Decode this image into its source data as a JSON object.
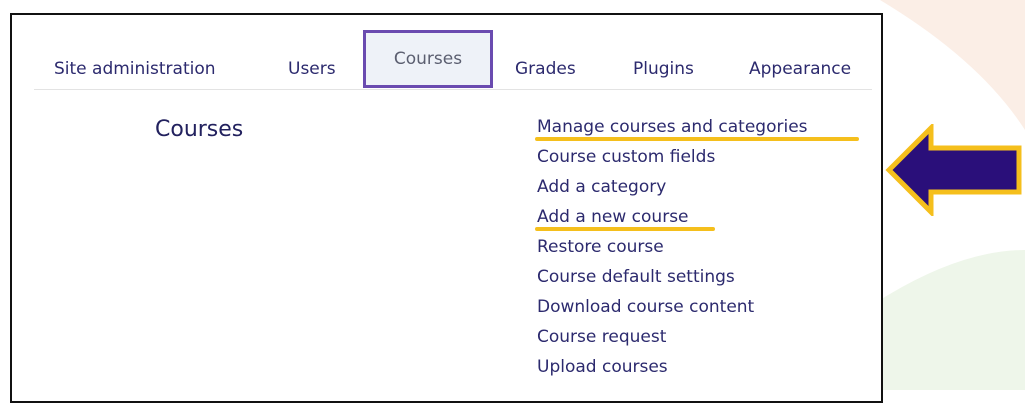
{
  "tabs": [
    {
      "label": "Site administration",
      "active": false
    },
    {
      "label": "Users",
      "active": false
    },
    {
      "label": "Courses",
      "active": true
    },
    {
      "label": "Grades",
      "active": false
    },
    {
      "label": "Plugins",
      "active": false
    },
    {
      "label": "Appearance",
      "active": false
    }
  ],
  "section": {
    "title": "Courses"
  },
  "links": [
    {
      "label": "Manage courses and categories",
      "highlighted": true
    },
    {
      "label": "Course custom fields",
      "highlighted": false
    },
    {
      "label": "Add a category",
      "highlighted": false
    },
    {
      "label": "Add a new course",
      "highlighted": true
    },
    {
      "label": "Restore course",
      "highlighted": false
    },
    {
      "label": "Course default settings",
      "highlighted": false
    },
    {
      "label": "Download course content",
      "highlighted": false
    },
    {
      "label": "Course request",
      "highlighted": false
    },
    {
      "label": "Upload courses",
      "highlighted": false
    }
  ],
  "annotation": {
    "arrow_icon": "arrow-left-icon",
    "arrow_color": "#2a0f7a",
    "arrow_outline": "#f5bf1c",
    "underline_color": "#f5bf1c"
  },
  "colors": {
    "accent": "#6a4bb0",
    "link": "#2c2a6e"
  }
}
